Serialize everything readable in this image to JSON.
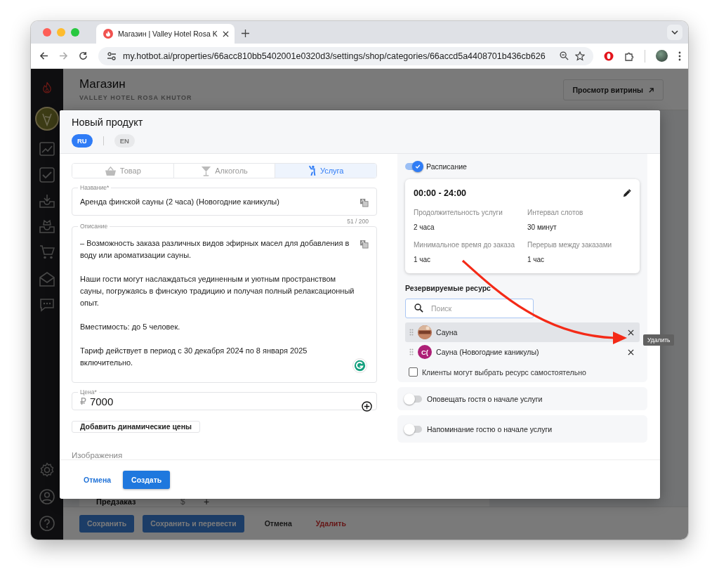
{
  "browser": {
    "tab_title": "Магазин | Valley Hotel Rosa K",
    "url": "my.hotbot.ai/properties/66acc810bb5402001e0320d3/settings/shop/categories/66accd5a4408701b436cb626"
  },
  "page": {
    "title": "Магазин",
    "subtitle": "VALLEY HOTEL ROSA KHUTOR",
    "storefront_button": "Просмотр витрины",
    "section_label": "Предзаказ",
    "currency": "$",
    "add": "+",
    "actions": [
      {
        "label": "Сохранить",
        "kind": "primary"
      },
      {
        "label": "Сохранить и перевести",
        "kind": "primary"
      },
      {
        "label": "Отмена",
        "kind": "text"
      },
      {
        "label": "Удалить",
        "kind": "danger"
      }
    ]
  },
  "modal": {
    "title": "Новый продукт",
    "languages": [
      {
        "label": "RU",
        "selected": true
      },
      {
        "label": "EN",
        "selected": false
      }
    ],
    "product_types": [
      {
        "label": "Товар",
        "kind": "goods",
        "selected": false
      },
      {
        "label": "Алкоголь",
        "kind": "alcohol",
        "selected": false
      },
      {
        "label": "Услуга",
        "kind": "service",
        "selected": true
      }
    ],
    "name_field": {
      "label": "Название*",
      "value": "Аренда финской сауны (2 часа) (Новогодние каникулы)"
    },
    "counter": "51 / 200",
    "description_field": {
      "label": "Описание",
      "paragraphs": [
        "– Возможность заказа различных видов эфирных масел для добавления в воду или ароматизации сауны.",
        "Наши гости могут наслаждаться уединенным и уютным пространством сауны, погружаясь в финскую традицию и получая полный релаксационный опыт.",
        "Вместимость: до 5 человек.",
        "Тариф действует в период с 30 декабря 2024 по 8 января 2025 включительно."
      ]
    },
    "price_field": {
      "label": "Цена*",
      "currency": "₽",
      "value": "7000"
    },
    "dynamic_prices_button": "Добавить динамические цены",
    "images_label": "Изображения",
    "schedule": {
      "label": "Расписание",
      "on": true,
      "time": "00:00 - 24:00",
      "details": [
        {
          "label": "Продолжительность услуги",
          "value": "2 часа"
        },
        {
          "label": "Интервал слотов",
          "value": "30 минут"
        },
        {
          "label": "Минимальное время до заказа",
          "value": "1 час"
        },
        {
          "label": "Перерыв между заказами",
          "value": "1 час"
        }
      ]
    },
    "resources": {
      "label": "Резервируемые ресурс",
      "search_placeholder": "Поиск",
      "items": [
        {
          "name": "Сауна",
          "selected": true
        },
        {
          "name": "Сауна (Новогодние каникулы)",
          "kind": "initials",
          "initials": "С(",
          "selected": false
        }
      ],
      "self_select": {
        "label": "Клиенты могут выбрать ресурс самостоятельно",
        "checked": false
      }
    },
    "toggles": [
      {
        "label": "Оповещать гостя о начале услуги",
        "on": false
      },
      {
        "label": "Напоминание гостю о начале услуги",
        "on": false
      }
    ],
    "footer_buttons": [
      {
        "label": "Отмена",
        "kind": "text"
      },
      {
        "label": "Создать",
        "kind": "primary"
      }
    ]
  },
  "tooltip": "Удалить"
}
